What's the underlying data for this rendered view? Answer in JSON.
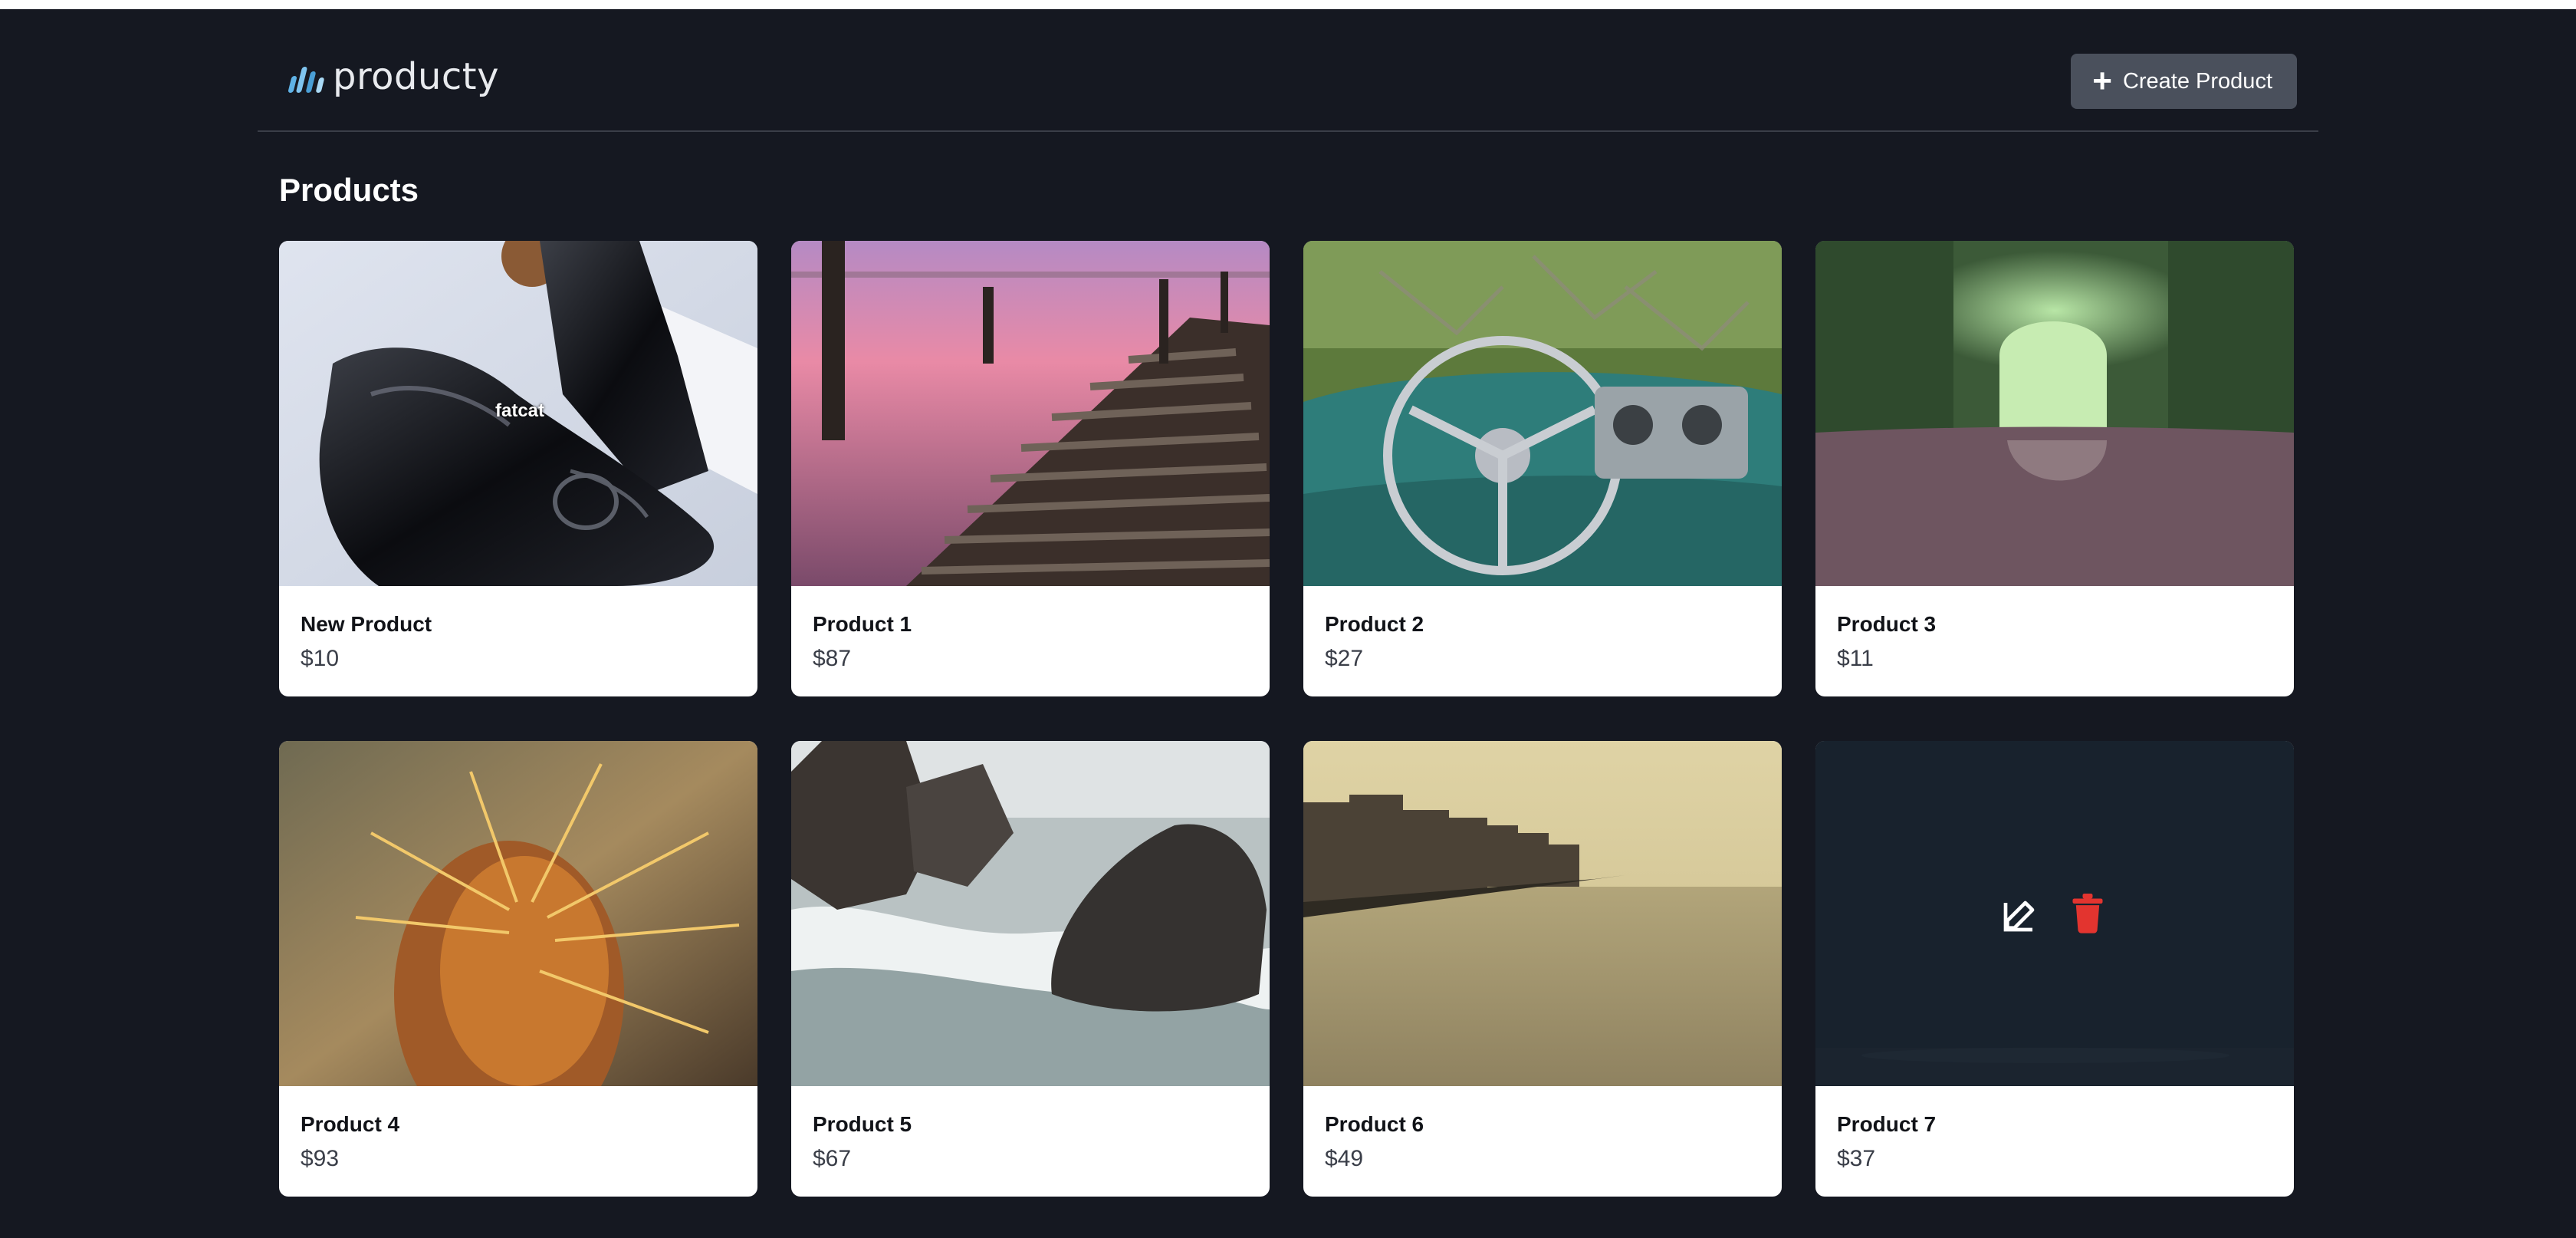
{
  "header": {
    "logo_text": "producty",
    "create_button_label": "Create Product"
  },
  "main": {
    "title": "Products",
    "products": [
      {
        "name": "New Product",
        "price": "$10",
        "image": "patent-leather-shoes"
      },
      {
        "name": "Product 1",
        "price": "$87",
        "image": "wooden-pier-sunset"
      },
      {
        "name": "Product 2",
        "price": "$27",
        "image": "vintage-car-dashboard"
      },
      {
        "name": "Product 3",
        "price": "$11",
        "image": "forest-tunnel-path"
      },
      {
        "name": "Product 4",
        "price": "$93",
        "image": "cactus-closeup"
      },
      {
        "name": "Product 5",
        "price": "$67",
        "image": "sea-rocks-waves"
      },
      {
        "name": "Product 6",
        "price": "$49",
        "image": "waterfront-buildings"
      },
      {
        "name": "Product 7",
        "price": "$37",
        "image": "dark-landscape"
      }
    ],
    "image_watermark": "fatcat"
  },
  "icons": {
    "edit": "edit-icon",
    "delete": "trash-icon",
    "plus": "plus-icon"
  },
  "colors": {
    "background": "#151821",
    "button": "#4a505c",
    "logo_accent": "#5fb2e6",
    "delete": "#e3342f"
  }
}
